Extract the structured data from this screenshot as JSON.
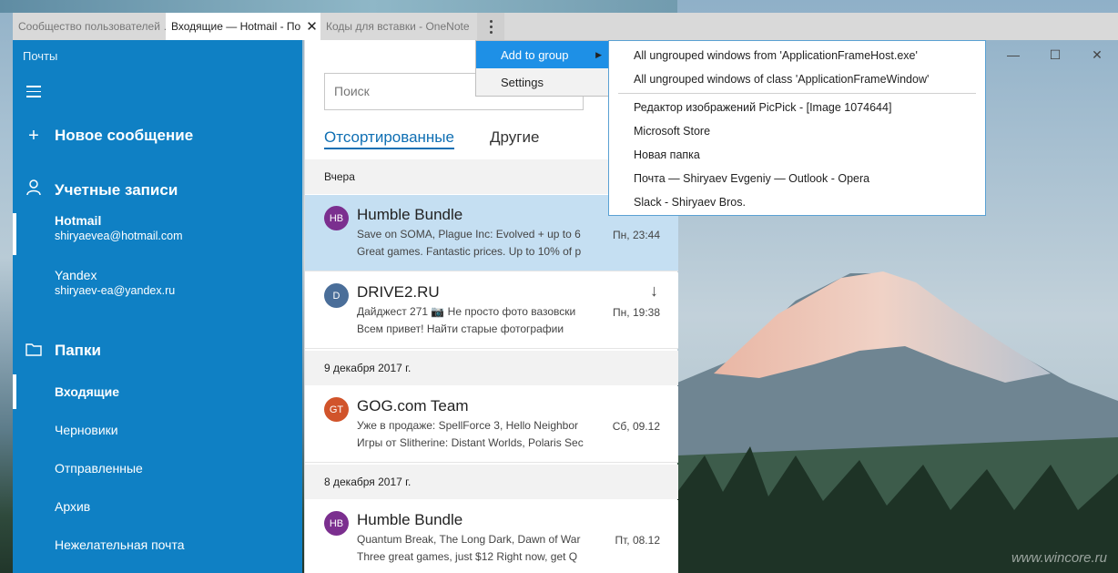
{
  "tabs": {
    "tab1": "Сообщество пользователей …",
    "tab2": "Входящие — Hotmail - По",
    "tab2_close": "✕",
    "tab3": "Коды для вставки - OneNote"
  },
  "app": {
    "title": "Почты"
  },
  "sidebar": {
    "new_message": "Новое сообщение",
    "accounts_label": "Учетные записи",
    "accounts": [
      {
        "name": "Hotmail",
        "email": "shiryaevea@hotmail.com"
      },
      {
        "name": "Yandex",
        "email": "shiryaev-ea@yandex.ru"
      }
    ],
    "folders_label": "Папки",
    "folders": [
      "Входящие",
      "Черновики",
      "Отправленные",
      "Архив",
      "Нежелательная почта"
    ]
  },
  "list": {
    "search_placeholder": "Поиск",
    "tab_sorted": "Отсортированные",
    "tab_other": "Другие",
    "groups": [
      "Вчера",
      "9 декабря 2017 г.",
      "8 декабря 2017 г."
    ],
    "messages": [
      {
        "initials": "HB",
        "color": "#7b2f8f",
        "sender": "Humble Bundle",
        "line1": "Save on SOMA, Plague Inc: Evolved + up to 6",
        "line2": "Great games. Fantastic prices.  Up to 10% of p",
        "date": "Пн, 23:44"
      },
      {
        "initials": "D",
        "color": "#4a6e99",
        "sender": "DRIVE2.RU",
        "line1": "Дайджест 271 📷 Не просто фото вазовски",
        "line2": "Всем привет!        Найти старые фотографии",
        "date": "Пн, 19:38"
      },
      {
        "initials": "GT",
        "color": "#d1542b",
        "sender": "GOG.com Team",
        "line1": "Уже в продаже: SpellForce 3, Hello Neighbor",
        "line2": "Игры от Slitherine: Distant Worlds, Polaris Sec",
        "date": "Сб, 09.12"
      },
      {
        "initials": "HB",
        "color": "#7b2f8f",
        "sender": "Humble Bundle",
        "line1": "Quantum Break, The Long Dark, Dawn of War",
        "line2": "Three great games, just $12  Right now, get Q",
        "date": "Пт, 08.12"
      }
    ]
  },
  "menu": {
    "add_to_group": "Add to group",
    "settings": "Settings",
    "submenu": [
      "All ungrouped windows from 'ApplicationFrameHost.exe'",
      "All ungrouped windows of class 'ApplicationFrameWindow'",
      "Редактор изображений PicPick - [Image 1074644]",
      "Microsoft Store",
      "Новая папка",
      "Почта — Shiryaev Evgeniy — Outlook - Opera",
      "Slack - Shiryaev Bros."
    ]
  },
  "watermark": "www.wincore.ru",
  "colors": {
    "accent": "#0f80c4",
    "selected": "#c5dff2",
    "menu_highlight": "#1e90e6"
  }
}
